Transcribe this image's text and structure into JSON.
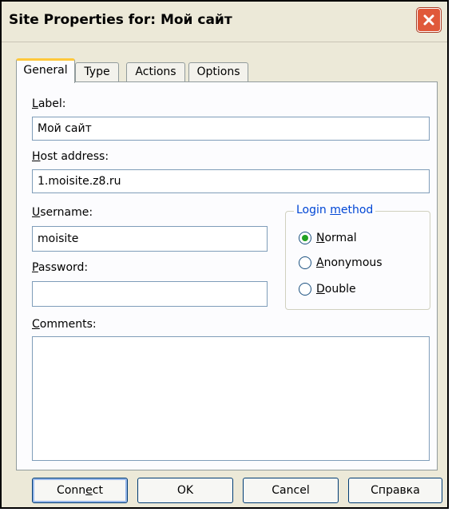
{
  "window": {
    "title": "Site Properties for: Мой сайт"
  },
  "tabs": [
    {
      "label": "General",
      "active": true
    },
    {
      "label": "Type",
      "active": false
    },
    {
      "label": "Actions",
      "active": false
    },
    {
      "label": "Options",
      "active": false
    }
  ],
  "form": {
    "label_title": "abel:",
    "label_mnemonic": "L",
    "label_value": "Мой сайт",
    "host_title": "ost address:",
    "host_mnemonic": "H",
    "host_value": "1.moisite.z8.ru",
    "username_title": "sername:",
    "username_mnemonic": "U",
    "username_value": "moisite",
    "password_title": "assword:",
    "password_mnemonic": "P",
    "password_value": "",
    "comments_title": "omments:",
    "comments_mnemonic": "C",
    "comments_value": ""
  },
  "login_method": {
    "title_pre": "Login ",
    "title_mnemonic": "m",
    "title_post": "ethod",
    "options": [
      {
        "mnemonic": "N",
        "rest": "ormal",
        "selected": true
      },
      {
        "mnemonic": "A",
        "rest": "nonymous",
        "selected": false
      },
      {
        "mnemonic": "D",
        "rest": "ouble",
        "selected": false
      }
    ]
  },
  "buttons": {
    "connect_pre": "Conn",
    "connect_mnemonic": "e",
    "connect_post": "ct",
    "ok": "OK",
    "cancel": "Cancel",
    "help": "Справка"
  },
  "colors": {
    "accent": "#0046d5",
    "close": "#e0593a",
    "tab_highlight": "#ffc83c",
    "radio_dot": "#21a121"
  },
  "icons": {
    "close": "close-icon"
  }
}
